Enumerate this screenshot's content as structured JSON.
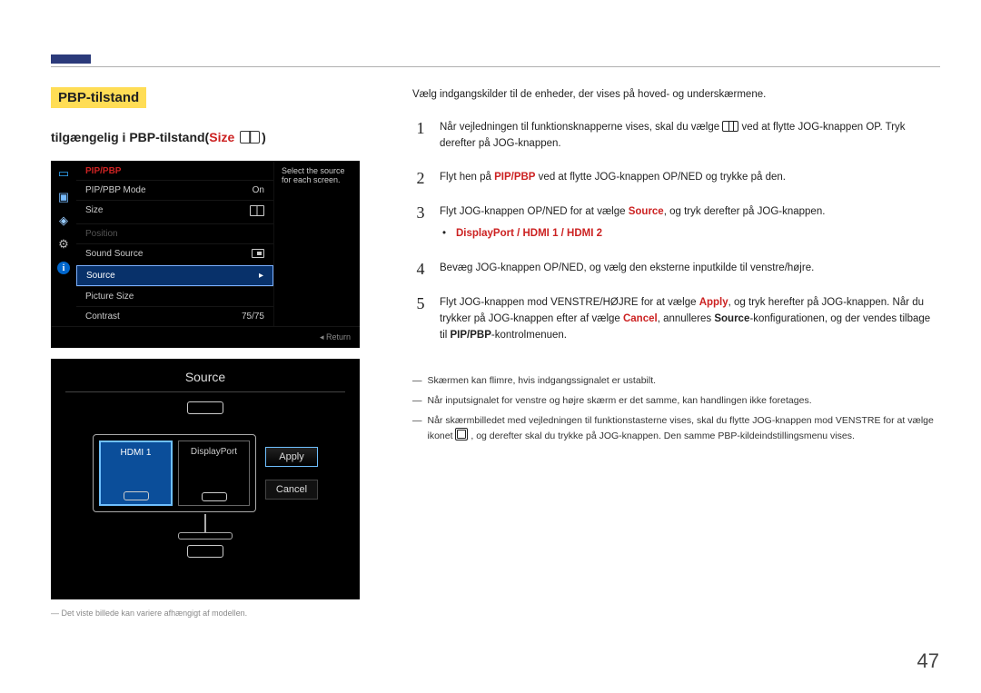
{
  "header": {
    "title": "PBP-tilstand",
    "subtitle_prefix": "tilgængelig i PBP-tilstand(",
    "subtitle_red": "Size",
    "subtitle_suffix": ")"
  },
  "osd1": {
    "menu_title": "PIP/PBP",
    "sidebar_text": "Select the source for each screen.",
    "rows": {
      "mode_label": "PIP/PBP Mode",
      "mode_val": "On",
      "size_label": "Size",
      "position_label": "Position",
      "sound_label": "Sound Source",
      "source_label": "Source",
      "picsize_label": "Picture Size",
      "contrast_label": "Contrast",
      "contrast_val": "75/75"
    },
    "return": "Return"
  },
  "osd2": {
    "title": "Source",
    "left_pane": "HDMI 1",
    "right_pane": "DisplayPort",
    "apply": "Apply",
    "cancel": "Cancel"
  },
  "left_note": "Det viste billede kan variere afhængigt af modellen.",
  "right": {
    "intro": "Vælg indgangskilder til de enheder, der vises på hoved- og underskærmene.",
    "step1_a": "Når vejledningen til funktionsknapperne vises, skal du vælge ",
    "step1_b": " ved at flytte JOG-knappen OP. Tryk derefter på JOG-knappen.",
    "step2_a": "Flyt hen på ",
    "step2_red": "PIP/PBP",
    "step2_b": " ved at flytte JOG-knappen OP/NED og trykke på den.",
    "step3_a": "Flyt JOG-knappen OP/NED for at vælge ",
    "step3_red": "Source",
    "step3_b": ", og tryk derefter på JOG-knappen.",
    "sub_bullet_red": "DisplayPort / HDMI 1 / HDMI 2",
    "step4": "Bevæg JOG-knappen OP/NED, og vælg den eksterne inputkilde til venstre/højre.",
    "step5_a": "Flyt JOG-knappen mod VENSTRE/HØJRE for at vælge ",
    "step5_apply": "Apply",
    "step5_b": ", og tryk herefter på JOG-knappen. Når du trykker på JOG-knappen efter af vælge ",
    "step5_cancel": "Cancel",
    "step5_c": ", annulleres ",
    "step5_source": "Source",
    "step5_d": "-konfigurationen, og der vendes tilbage til ",
    "step5_pip": "PIP/PBP",
    "step5_e": "-kontrolmenuen.",
    "note1": "Skærmen kan flimre, hvis indgangssignalet er ustabilt.",
    "note2": "Når inputsignalet for venstre og højre skærm er det samme, kan handlingen ikke foretages.",
    "note3_a": "Når skærmbilledet med vejledningen til funktionstasterne vises, skal du flytte JOG-knappen mod VENSTRE for at vælge ikonet ",
    "note3_b": ", og derefter skal du trykke på JOG-knappen. Den samme PBP-kildeindstillingsmenu vises."
  },
  "page": "47"
}
